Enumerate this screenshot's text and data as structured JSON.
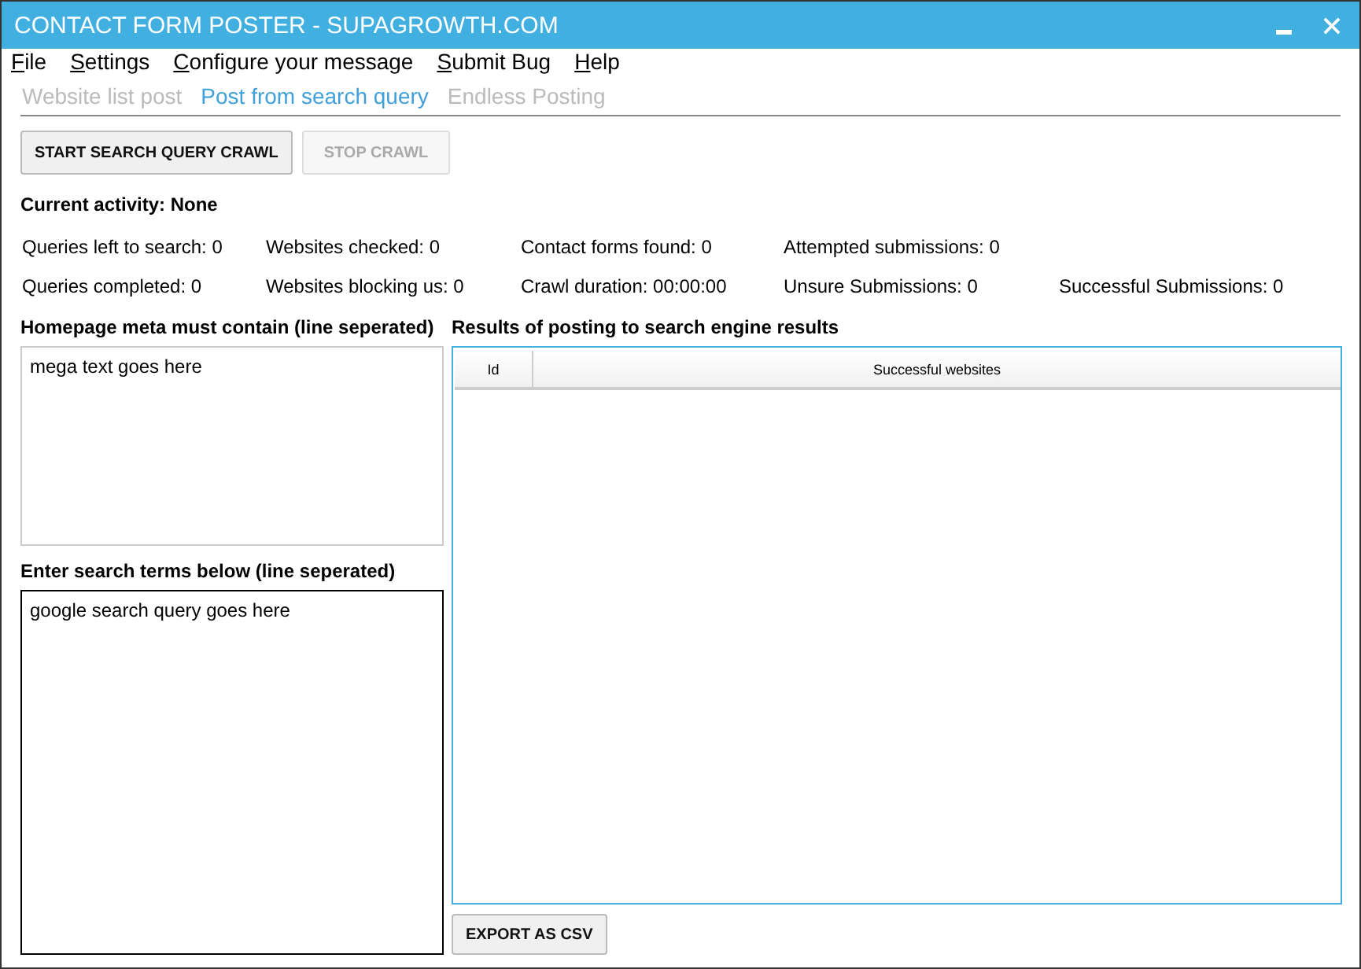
{
  "window": {
    "title": "CONTACT FORM POSTER - SUPAGROWTH.COM"
  },
  "menu": [
    "File",
    "Settings",
    "Configure your message",
    "Submit Bug",
    "Help"
  ],
  "tabs": [
    {
      "label": "Website list post",
      "selected": false
    },
    {
      "label": "Post from search query",
      "selected": true
    },
    {
      "label": "Endless Posting",
      "selected": false
    }
  ],
  "actions": [
    {
      "label": "START SEARCH QUERY CRAWL",
      "disabled": false
    },
    {
      "label": "STOP CRAWL",
      "disabled": true
    }
  ],
  "current_activity": "Current activity: None",
  "stats": [
    [
      "Queries left to search: 0",
      "Websites checked: 0",
      "Contact forms found: 0",
      "Attempted submissions: 0"
    ],
    [
      "Queries completed: 0",
      "Websites blocking us: 0",
      "Crawl duration: 00:00:00",
      "Unsure Submissions: 0",
      "Successful Submissions: 0"
    ]
  ],
  "meta_field": {
    "label": "Homepage meta must contain (line seperated)",
    "value": "mega text goes here",
    "focused": false
  },
  "terms_field": {
    "label": "Enter search terms below (line seperated)",
    "value": "google search query goes here",
    "focused": true
  },
  "results": {
    "title": "Results of posting to search engine results",
    "columns": [
      "Id",
      "Successful websites"
    ]
  },
  "export_button": "EXPORT AS CSV"
}
